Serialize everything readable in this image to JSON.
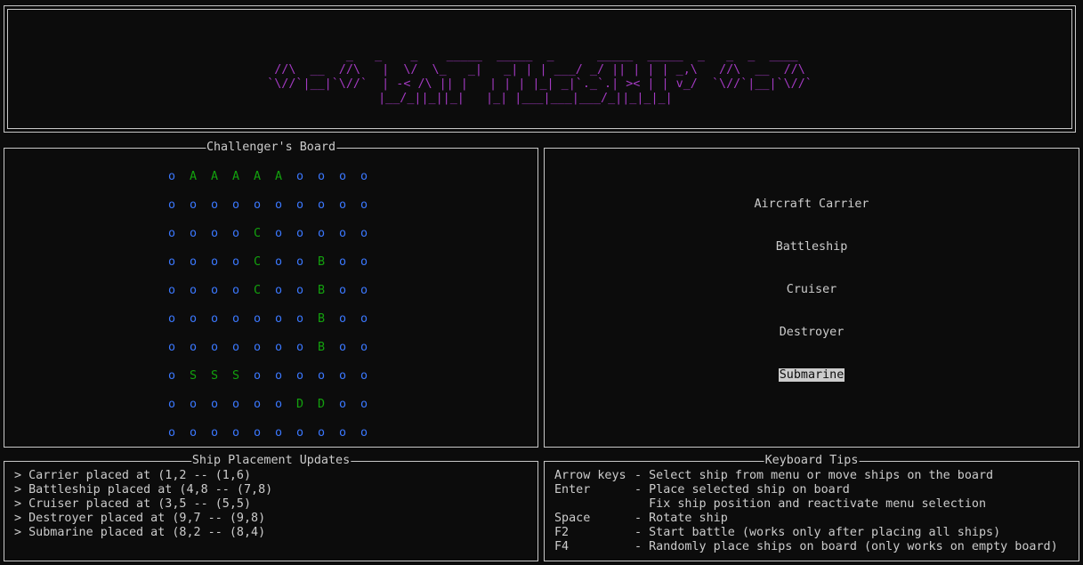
{
  "banner": {
    "ascii_art": [
      "                                    _   _    _    _____  _____  _      _____  _____  _   _  _  ____                           ",
      "  //\\  __  //\\   |  \\/  \\_   _|   _| | | ___/ _/ || | | | _,\\   //\\  __  //\\  ",
      " `\\//`|__|`\\//`  | -< /\\ || |   | | | |_| _|`._`.| >< | | v_/  `\\//`|__|`\\//` ",
      "                 |__/_||_||_|   |_| |___|___|___/_||_|_|_|                     "
    ]
  },
  "boards": {
    "challenger": {
      "title": "Challenger's Board",
      "rows": [
        [
          "o",
          "A",
          "A",
          "A",
          "A",
          "A",
          "o",
          "o",
          "o",
          "o"
        ],
        [
          "o",
          "o",
          "o",
          "o",
          "o",
          "o",
          "o",
          "o",
          "o",
          "o"
        ],
        [
          "o",
          "o",
          "o",
          "o",
          "C",
          "o",
          "o",
          "o",
          "o",
          "o"
        ],
        [
          "o",
          "o",
          "o",
          "o",
          "C",
          "o",
          "o",
          "B",
          "o",
          "o"
        ],
        [
          "o",
          "o",
          "o",
          "o",
          "C",
          "o",
          "o",
          "B",
          "o",
          "o"
        ],
        [
          "o",
          "o",
          "o",
          "o",
          "o",
          "o",
          "o",
          "B",
          "o",
          "o"
        ],
        [
          "o",
          "o",
          "o",
          "o",
          "o",
          "o",
          "o",
          "B",
          "o",
          "o"
        ],
        [
          "o",
          "S",
          "S",
          "S",
          "o",
          "o",
          "o",
          "o",
          "o",
          "o"
        ],
        [
          "o",
          "o",
          "o",
          "o",
          "o",
          "o",
          "D",
          "D",
          "o",
          "o"
        ],
        [
          "o",
          "o",
          "o",
          "o",
          "o",
          "o",
          "o",
          "o",
          "o",
          "o"
        ]
      ]
    }
  },
  "ship_menu": {
    "items": [
      "Aircraft Carrier",
      "Battleship",
      "Cruiser",
      "Destroyer",
      "Submarine"
    ],
    "selected": "Submarine"
  },
  "updates": {
    "title": "Ship Placement Updates",
    "lines": [
      "> Carrier placed at (1,2 -- (1,6)",
      "> Battleship placed at (4,8 -- (7,8)",
      "> Cruiser placed at (3,5 -- (5,5)",
      "> Destroyer placed at (9,7 -- (9,8)",
      "> Submarine placed at (8,2 -- (8,4)"
    ]
  },
  "tips": {
    "title": "Keyboard Tips",
    "rows": [
      {
        "key": "Arrow keys",
        "text": "Select ship from menu or move ships on the board"
      },
      {
        "key": "Enter",
        "text": "Place selected ship on board"
      },
      {
        "key": "",
        "text": "Fix ship position and reactivate menu selection"
      },
      {
        "key": "Space",
        "text": "Rotate ship"
      },
      {
        "key": "F2",
        "text": "Start battle (works only after placing all ships)"
      },
      {
        "key": "F4",
        "text": "Randomly place ships on board (only works on empty board)"
      }
    ]
  },
  "colors": {
    "water": "#3b78ff",
    "ship": "#13a10e",
    "banner": "#a33ac2",
    "border": "#c8c8c8",
    "background": "#0c0c0c"
  }
}
